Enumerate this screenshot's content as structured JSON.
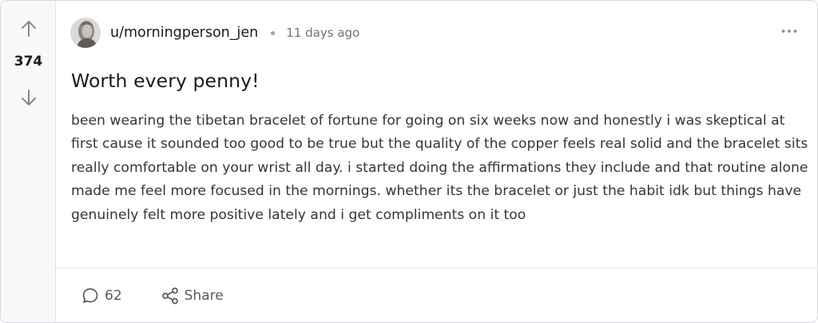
{
  "post": {
    "votes": "374",
    "author": "u/morningperson_jen",
    "time_ago": "11 days ago",
    "title": "Worth every penny!",
    "body": "been wearing the tibetan bracelet of fortune for going on six weeks now and honestly i was skeptical at first cause it sounded too good to be true but the quality of the copper feels real solid and the bracelet sits really comfortable on your wrist all day. i started doing the affirmations they include and that routine alone made me feel more focused in the mornings. whether its the bracelet or just the habit idk but things have genuinely felt more positive lately and i get compliments on it too"
  },
  "actions": {
    "comments_count": "62",
    "share_label": "Share"
  },
  "icons": {
    "upvote": "arrow-up-icon",
    "downvote": "arrow-down-icon",
    "more": "more-horizontal-icon",
    "comment": "comment-bubble-icon",
    "share": "share-nodes-icon"
  },
  "colors": {
    "vote_column_bg": "#f7f8f9",
    "text_primary": "#1a1a1b",
    "text_muted": "#6f7378",
    "border": "#d6d8db"
  }
}
